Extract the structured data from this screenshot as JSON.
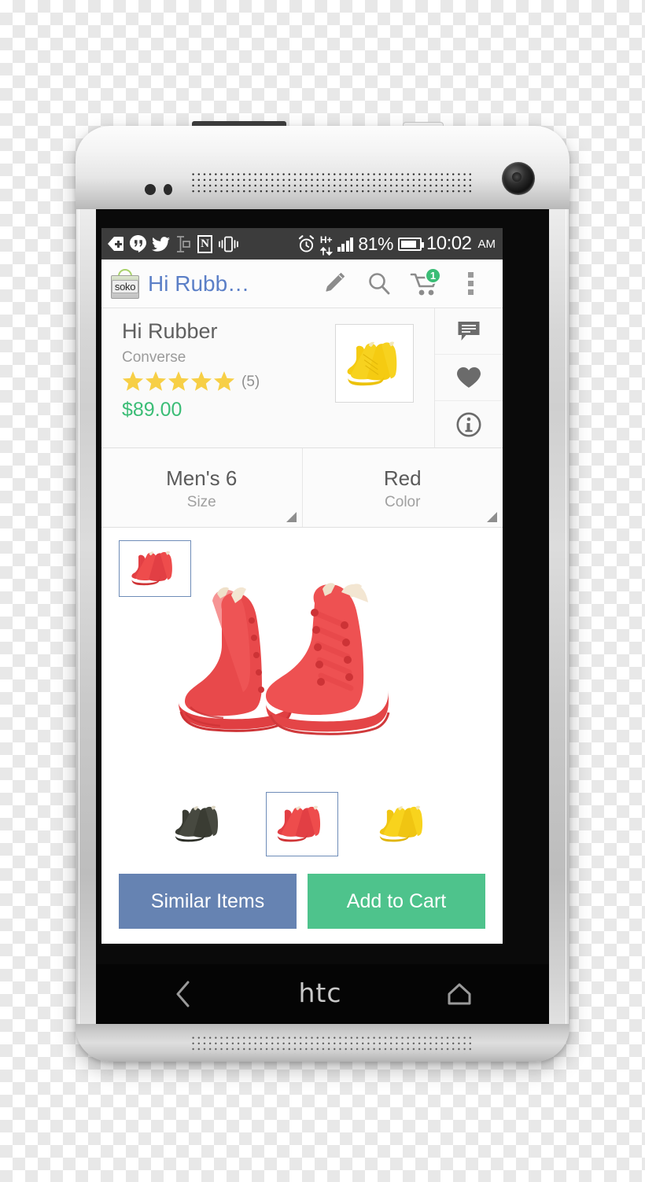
{
  "device": {
    "brand_logo": "htc",
    "nav": {
      "back_icon": "back-chevron-icon",
      "home_icon": "home-icon"
    }
  },
  "status_bar": {
    "left_icons": [
      "tag-plus-icon",
      "hangouts-icon",
      "twitter-icon",
      "text-cursor-icon",
      "nfc-icon",
      "vibrate-icon"
    ],
    "alarm_icon": "alarm-clock-icon",
    "network_type": "H+",
    "network_arrows_icon": "up-down-arrows-icon",
    "signal_icon": "signal-bars-icon",
    "battery_percent": "81%",
    "battery_icon": "battery-icon",
    "time": "10:02",
    "meridiem": "AM",
    "background": "#3c3c3c"
  },
  "app_bar": {
    "logo_text": "soko",
    "logo_name": "soko-bag-logo",
    "title": "Hi Rubb…",
    "title_color": "#5b7fc7",
    "actions": [
      {
        "name": "edit-button",
        "icon": "pencil-icon"
      },
      {
        "name": "search-button",
        "icon": "search-icon"
      },
      {
        "name": "cart-button",
        "icon": "shopping-cart-icon",
        "badge": "1",
        "badge_color": "#3bbd76"
      },
      {
        "name": "overflow-button",
        "icon": "kebab-menu-icon"
      }
    ]
  },
  "product": {
    "name": "Hi Rubber",
    "brand": "Converse",
    "rating_stars": 5,
    "rating_count": "(5)",
    "star_color": "#f7cf46",
    "price": "$89.00",
    "price_color": "#3bbd76",
    "thumbnail_alt": "yellow-converse-high-top"
  },
  "rail": [
    {
      "name": "reviews-button",
      "icon": "comment-icon"
    },
    {
      "name": "favorite-button",
      "icon": "heart-icon"
    },
    {
      "name": "info-button",
      "icon": "info-circle-icon"
    }
  ],
  "selectors": [
    {
      "name": "size-selector",
      "value": "Men's 6",
      "label": "Size"
    },
    {
      "name": "color-selector",
      "value": "Red",
      "label": "Color"
    }
  ],
  "gallery": {
    "thumb_alt": "red-converse-high-top-thumbnail",
    "hero_alt": "red-converse-chuck-taylor-high-top-pair",
    "swatches": [
      {
        "name": "swatch-black",
        "alt": "black-converse-high-top",
        "selected": false
      },
      {
        "name": "swatch-red",
        "alt": "red-converse-high-top",
        "selected": true
      },
      {
        "name": "swatch-yellow",
        "alt": "yellow-converse-high-top",
        "selected": false
      }
    ]
  },
  "buttons": {
    "similar": {
      "label": "Similar Items",
      "color": "#6683b2"
    },
    "cart": {
      "label": "Add to Cart",
      "color": "#4ec38c"
    }
  }
}
